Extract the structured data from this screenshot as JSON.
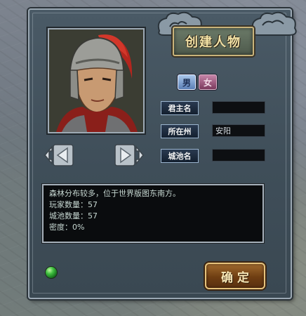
{
  "dialog": {
    "title": "创建人物"
  },
  "gender": {
    "male_label": "男",
    "female_label": "女"
  },
  "fields": {
    "lord_name_label": "君主名",
    "lord_name_value": "",
    "state_label": "所在州",
    "state_value": "安阳",
    "city_label": "城池名",
    "city_value": ""
  },
  "info": {
    "lines": [
      "森林分布较多，位于世界版图东南方。",
      "玩家数量：57",
      "城池数量：57",
      "密度：0%"
    ]
  },
  "buttons": {
    "confirm_label": "确定"
  },
  "colors": {
    "panel": "#3f4e59",
    "title_text": "#f4e3a6",
    "confirm_button": "#6e3e12",
    "orb": "#3fbf3f"
  },
  "icons": {
    "prev": "left-arrow-icon",
    "next": "right-arrow-icon",
    "status": "green-orb-icon"
  }
}
